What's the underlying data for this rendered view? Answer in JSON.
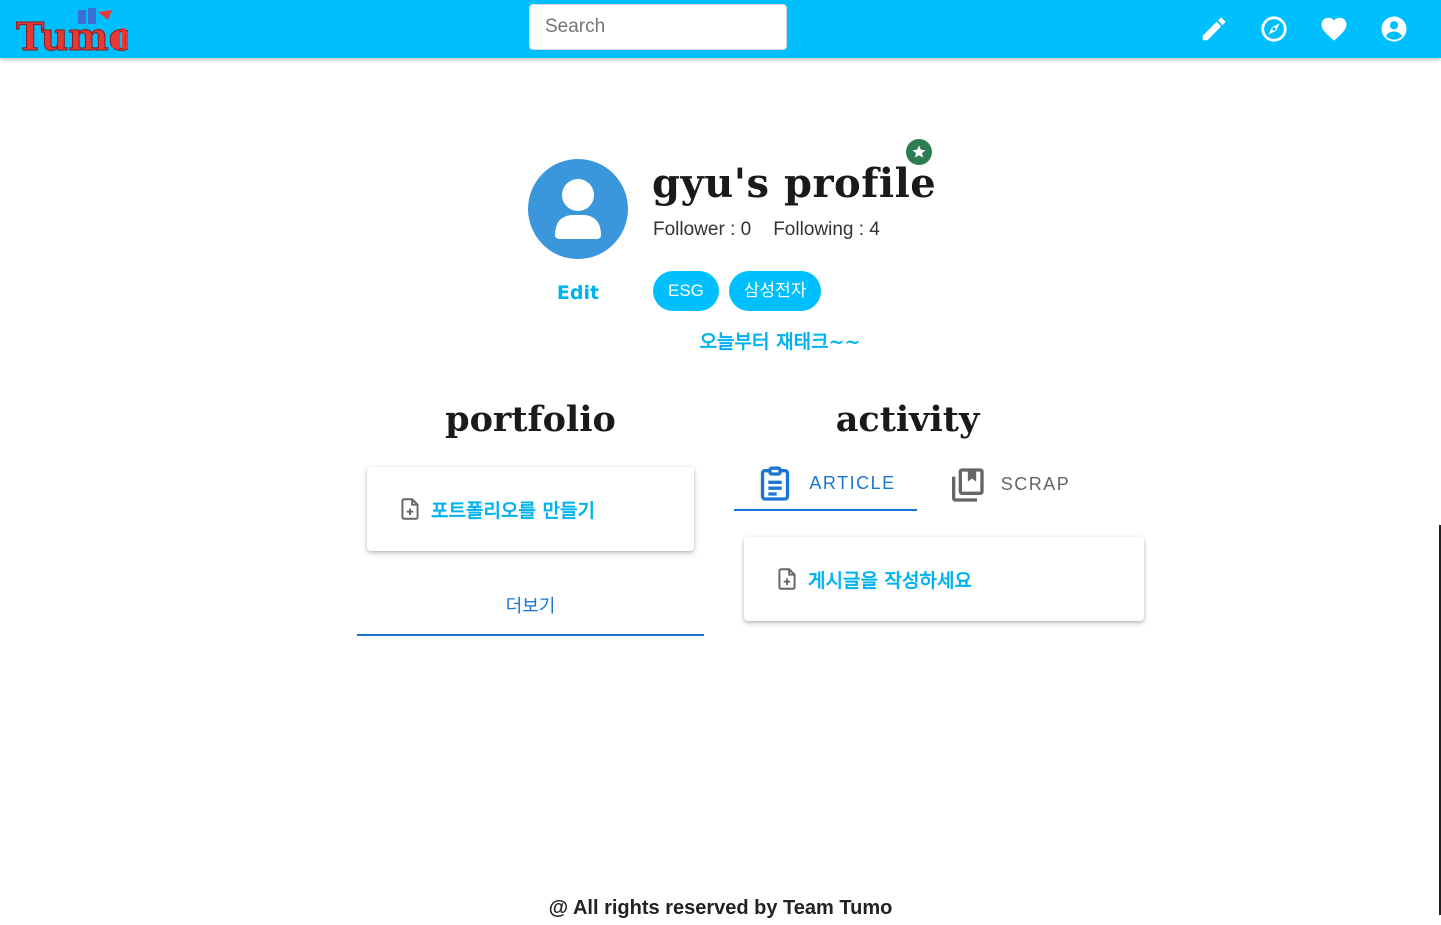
{
  "header": {
    "logo_alt": "Tumo",
    "search_placeholder": "Search",
    "icons": [
      "pencil-icon",
      "compass-icon",
      "heart-icon",
      "account-circle-icon"
    ],
    "brand_color": "#00bfff"
  },
  "profile": {
    "title": "gyu's profile",
    "edit_label": "Edit",
    "follower": "Follower : 0",
    "following": "Following : 4",
    "tags": [
      "ESG",
      "삼성전자"
    ],
    "bio": "오늘부터 재태크~~",
    "badge_icon": "star-badge-icon",
    "badge_color": "#2e7d52"
  },
  "portfolio": {
    "title": "portfolio",
    "create_label": "포트폴리오를 만들기",
    "more_label": "더보기"
  },
  "activity": {
    "title": "activity",
    "tabs": [
      {
        "label": "ARTICLE",
        "icon": "clipboard-icon",
        "active": true
      },
      {
        "label": "SCRAP",
        "icon": "bookmarks-icon",
        "active": false
      }
    ],
    "write_label": "게시글을 작성하세요"
  },
  "footer": {
    "text": "@ All rights reserved by Team Tumo"
  },
  "accent_color": "#00b2f0",
  "tab_active_color": "#1976d2"
}
